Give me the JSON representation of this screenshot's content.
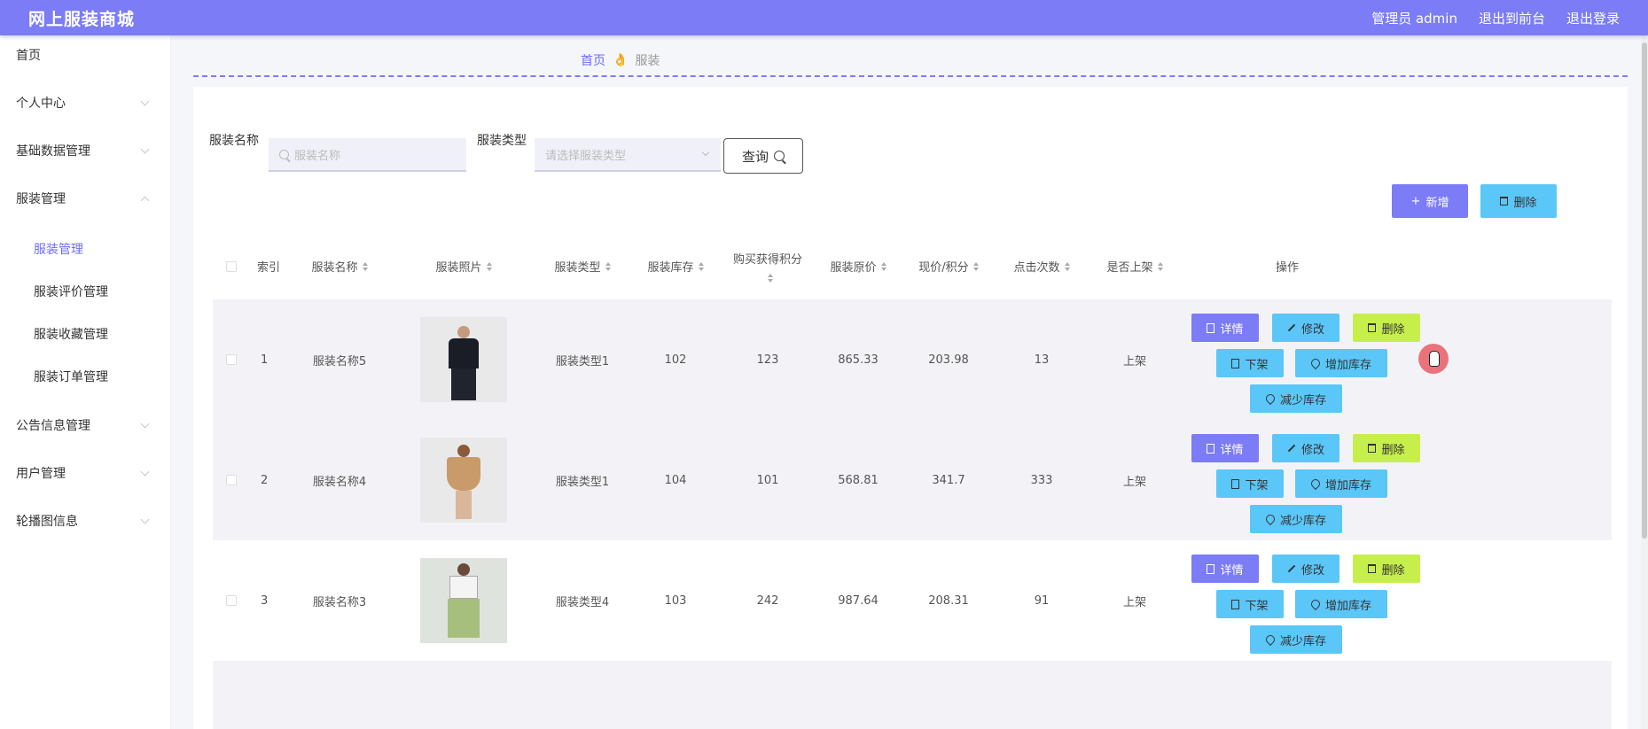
{
  "header": {
    "title": "网上服装商城",
    "admin": "管理员 admin",
    "to_front": "退出到前台",
    "logout": "退出登录"
  },
  "sidebar": {
    "items": [
      {
        "label": "首页"
      },
      {
        "label": "个人中心"
      },
      {
        "label": "基础数据管理"
      },
      {
        "label": "服装管理"
      },
      {
        "label": "公告信息管理"
      },
      {
        "label": "用户管理"
      },
      {
        "label": "轮播图信息"
      }
    ],
    "sub_items": [
      {
        "label": "服装管理"
      },
      {
        "label": "服装评价管理"
      },
      {
        "label": "服装收藏管理"
      },
      {
        "label": "服装订单管理"
      }
    ]
  },
  "breadcrumb": {
    "home": "首页",
    "sep_icon": "hand-icon",
    "current": "服装"
  },
  "search": {
    "name_label": "服装名称",
    "name_placeholder": "服装名称",
    "type_label": "服装类型",
    "type_placeholder": "请选择服装类型",
    "query_label": "查询"
  },
  "toolbar": {
    "add_label": "新增",
    "delete_label": "删除"
  },
  "table": {
    "headers": {
      "index": "索引",
      "name": "服装名称",
      "photo": "服装照片",
      "type": "服装类型",
      "stock": "服装库存",
      "points": "购买获得积分",
      "orig_price": "服装原价",
      "price": "现价/积分",
      "clicks": "点击次数",
      "on_shelf": "是否上架",
      "actions": "操作"
    },
    "rows": [
      {
        "index": "1",
        "name": "服装名称5",
        "type": "服装类型1",
        "stock": "102",
        "points": "123",
        "orig_price": "865.33",
        "price": "203.98",
        "clicks": "13",
        "on_shelf": "上架"
      },
      {
        "index": "2",
        "name": "服装名称4",
        "type": "服装类型1",
        "stock": "104",
        "points": "101",
        "orig_price": "568.81",
        "price": "341.7",
        "clicks": "333",
        "on_shelf": "上架"
      },
      {
        "index": "3",
        "name": "服装名称3",
        "type": "服装类型4",
        "stock": "103",
        "points": "242",
        "orig_price": "987.64",
        "price": "208.31",
        "clicks": "91",
        "on_shelf": "上架"
      }
    ],
    "actions": {
      "detail": "详情",
      "edit": "修改",
      "delete": "删除",
      "off_shelf": "下架",
      "add_stock": "增加库存",
      "reduce_stock": "减少库存"
    }
  },
  "colors": {
    "accent": "#7b7cf6",
    "info": "#5bc6f8",
    "warning": "#c7ef4c"
  }
}
